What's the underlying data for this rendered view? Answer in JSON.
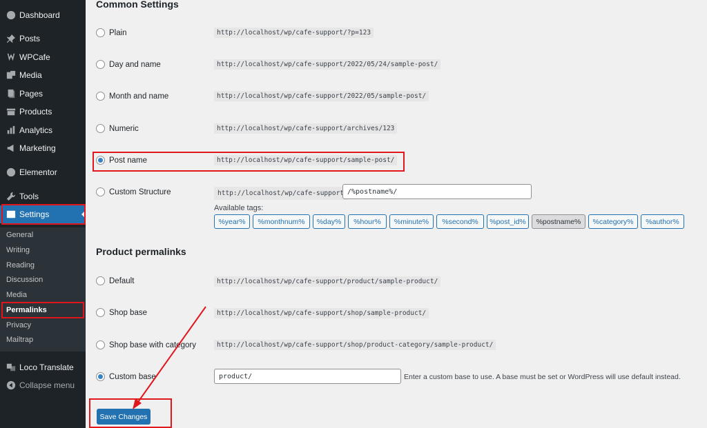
{
  "sidebar": {
    "items": [
      {
        "label": "Dashboard",
        "icon": "dashboard-icon"
      },
      {
        "label": "Posts",
        "icon": "pin-icon"
      },
      {
        "label": "WPCafe",
        "icon": "cafe-icon"
      },
      {
        "label": "Media",
        "icon": "media-icon"
      },
      {
        "label": "Pages",
        "icon": "pages-icon"
      },
      {
        "label": "Products",
        "icon": "products-icon"
      },
      {
        "label": "Analytics",
        "icon": "analytics-icon"
      },
      {
        "label": "Marketing",
        "icon": "megaphone-icon"
      },
      {
        "label": "Elementor",
        "icon": "elementor-icon"
      },
      {
        "label": "Tools",
        "icon": "wrench-icon"
      },
      {
        "label": "Settings",
        "icon": "settings-icon"
      },
      {
        "label": "Loco Translate",
        "icon": "translate-icon"
      },
      {
        "label": "Collapse menu",
        "icon": "collapse-icon"
      }
    ],
    "submenu": [
      "General",
      "Writing",
      "Reading",
      "Discussion",
      "Media",
      "Permalinks",
      "Privacy",
      "Mailtrap"
    ]
  },
  "common": {
    "title": "Common Settings",
    "options": [
      {
        "label": "Plain",
        "code": "http://localhost/wp/cafe-support/?p=123"
      },
      {
        "label": "Day and name",
        "code": "http://localhost/wp/cafe-support/2022/05/24/sample-post/"
      },
      {
        "label": "Month and name",
        "code": "http://localhost/wp/cafe-support/2022/05/sample-post/"
      },
      {
        "label": "Numeric",
        "code": "http://localhost/wp/cafe-support/archives/123"
      },
      {
        "label": "Post name",
        "code": "http://localhost/wp/cafe-support/sample-post/"
      },
      {
        "label": "Custom Structure",
        "code": "http://localhost/wp/cafe-support"
      }
    ],
    "custom_value": "/%postname%/",
    "available_tags_label": "Available tags:",
    "tags": [
      "%year%",
      "%monthnum%",
      "%day%",
      "%hour%",
      "%minute%",
      "%second%",
      "%post_id%",
      "%postname%",
      "%category%",
      "%author%"
    ]
  },
  "product": {
    "title": "Product permalinks",
    "options": [
      {
        "label": "Default",
        "code": "http://localhost/wp/cafe-support/product/sample-product/"
      },
      {
        "label": "Shop base",
        "code": "http://localhost/wp/cafe-support/shop/sample-product/"
      },
      {
        "label": "Shop base with category",
        "code": "http://localhost/wp/cafe-support/shop/product-category/sample-product/"
      },
      {
        "label": "Custom base",
        "code": ""
      }
    ],
    "custom_base_value": "product/",
    "custom_base_desc": "Enter a custom base to use. A base must be set or WordPress will use default instead."
  },
  "save_label": "Save Changes",
  "colors": {
    "sidebar_bg": "#1d2327",
    "accent": "#2271b1",
    "annotation": "#e0161b"
  }
}
